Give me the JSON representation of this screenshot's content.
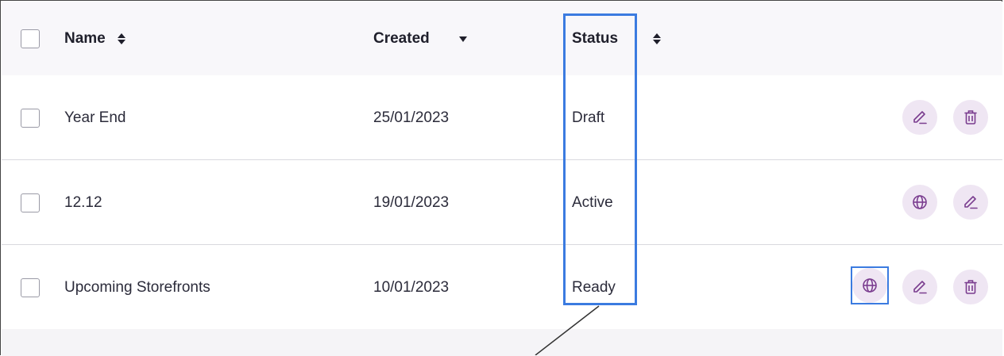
{
  "table": {
    "headers": {
      "name": "Name",
      "created": "Created",
      "status": "Status"
    },
    "rows": [
      {
        "name": "Year End",
        "created": "25/01/2023",
        "status": "Draft",
        "actions": [
          "edit-icon",
          "trash-icon"
        ]
      },
      {
        "name": "12.12",
        "created": "19/01/2023",
        "status": "Active",
        "actions": [
          "globe-icon",
          "edit-icon"
        ]
      },
      {
        "name": "Upcoming Storefronts",
        "created": "10/01/2023",
        "status": "Ready",
        "actions": [
          "globe-icon",
          "edit-icon",
          "trash-icon"
        ]
      }
    ]
  },
  "colors": {
    "accent": "#7a3d8f",
    "action_bg": "#efe6f3",
    "highlight": "#3b7be0",
    "header_bg": "#f8f7fa"
  }
}
